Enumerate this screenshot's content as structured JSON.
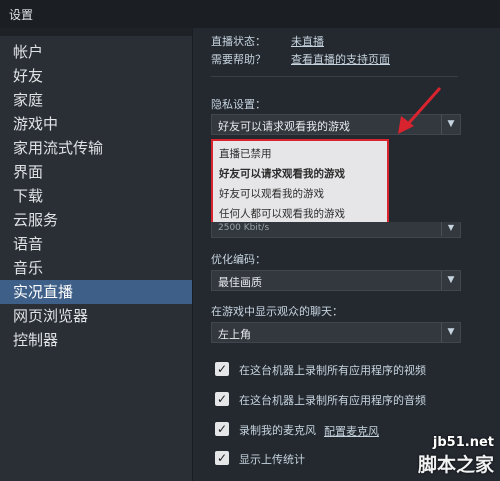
{
  "window": {
    "title": "设置"
  },
  "sidebar": {
    "items": [
      {
        "label": "帐户",
        "name": "sidebar-item-account"
      },
      {
        "label": "好友",
        "name": "sidebar-item-friends"
      },
      {
        "label": "家庭",
        "name": "sidebar-item-family"
      },
      {
        "label": "游戏中",
        "name": "sidebar-item-in-game"
      },
      {
        "label": "家用流式传输",
        "name": "sidebar-item-in-home-streaming"
      },
      {
        "label": "界面",
        "name": "sidebar-item-interface"
      },
      {
        "label": "下载",
        "name": "sidebar-item-downloads"
      },
      {
        "label": "云服务",
        "name": "sidebar-item-cloud"
      },
      {
        "label": "语音",
        "name": "sidebar-item-voice"
      },
      {
        "label": "音乐",
        "name": "sidebar-item-music"
      },
      {
        "label": "实况直播",
        "name": "sidebar-item-broadcasting"
      },
      {
        "label": "网页浏览器",
        "name": "sidebar-item-web-browser"
      },
      {
        "label": "控制器",
        "name": "sidebar-item-controller"
      }
    ],
    "active_index": 10
  },
  "main": {
    "status_label": "直播状态：",
    "status_value": "未直播",
    "help_label": "需要帮助？",
    "help_link": "查看直播的支持页面",
    "privacy_label": "隐私设置：",
    "privacy_selected": "好友可以请求观看我的游戏",
    "privacy_options": [
      "直播已禁用",
      "好友可以请求观看我的游戏",
      "好友可以观看我的游戏",
      "任何人都可以观看我的游戏"
    ],
    "bitrate_partial": "2500 Kbit/s",
    "encoding_label": "优化编码：",
    "encoding_selected": "最佳画质",
    "chat_label": "在游戏中显示观众的聊天：",
    "chat_selected": "左上角",
    "checkboxes": [
      {
        "label": "在这台机器上录制所有应用程序的视频",
        "checked": true
      },
      {
        "label": "在这台机器上录制所有应用程序的音频",
        "checked": true
      },
      {
        "label": "录制我的麦克风",
        "checked": true
      },
      {
        "label": "显示上传统计",
        "checked": true
      }
    ],
    "mic_config_link": "配置麦克风"
  },
  "watermark": {
    "site": "jb51.net",
    "name": "脚本之家"
  },
  "colors": {
    "annotation_red": "#d9232e",
    "active_nav": "#3e5f87"
  }
}
